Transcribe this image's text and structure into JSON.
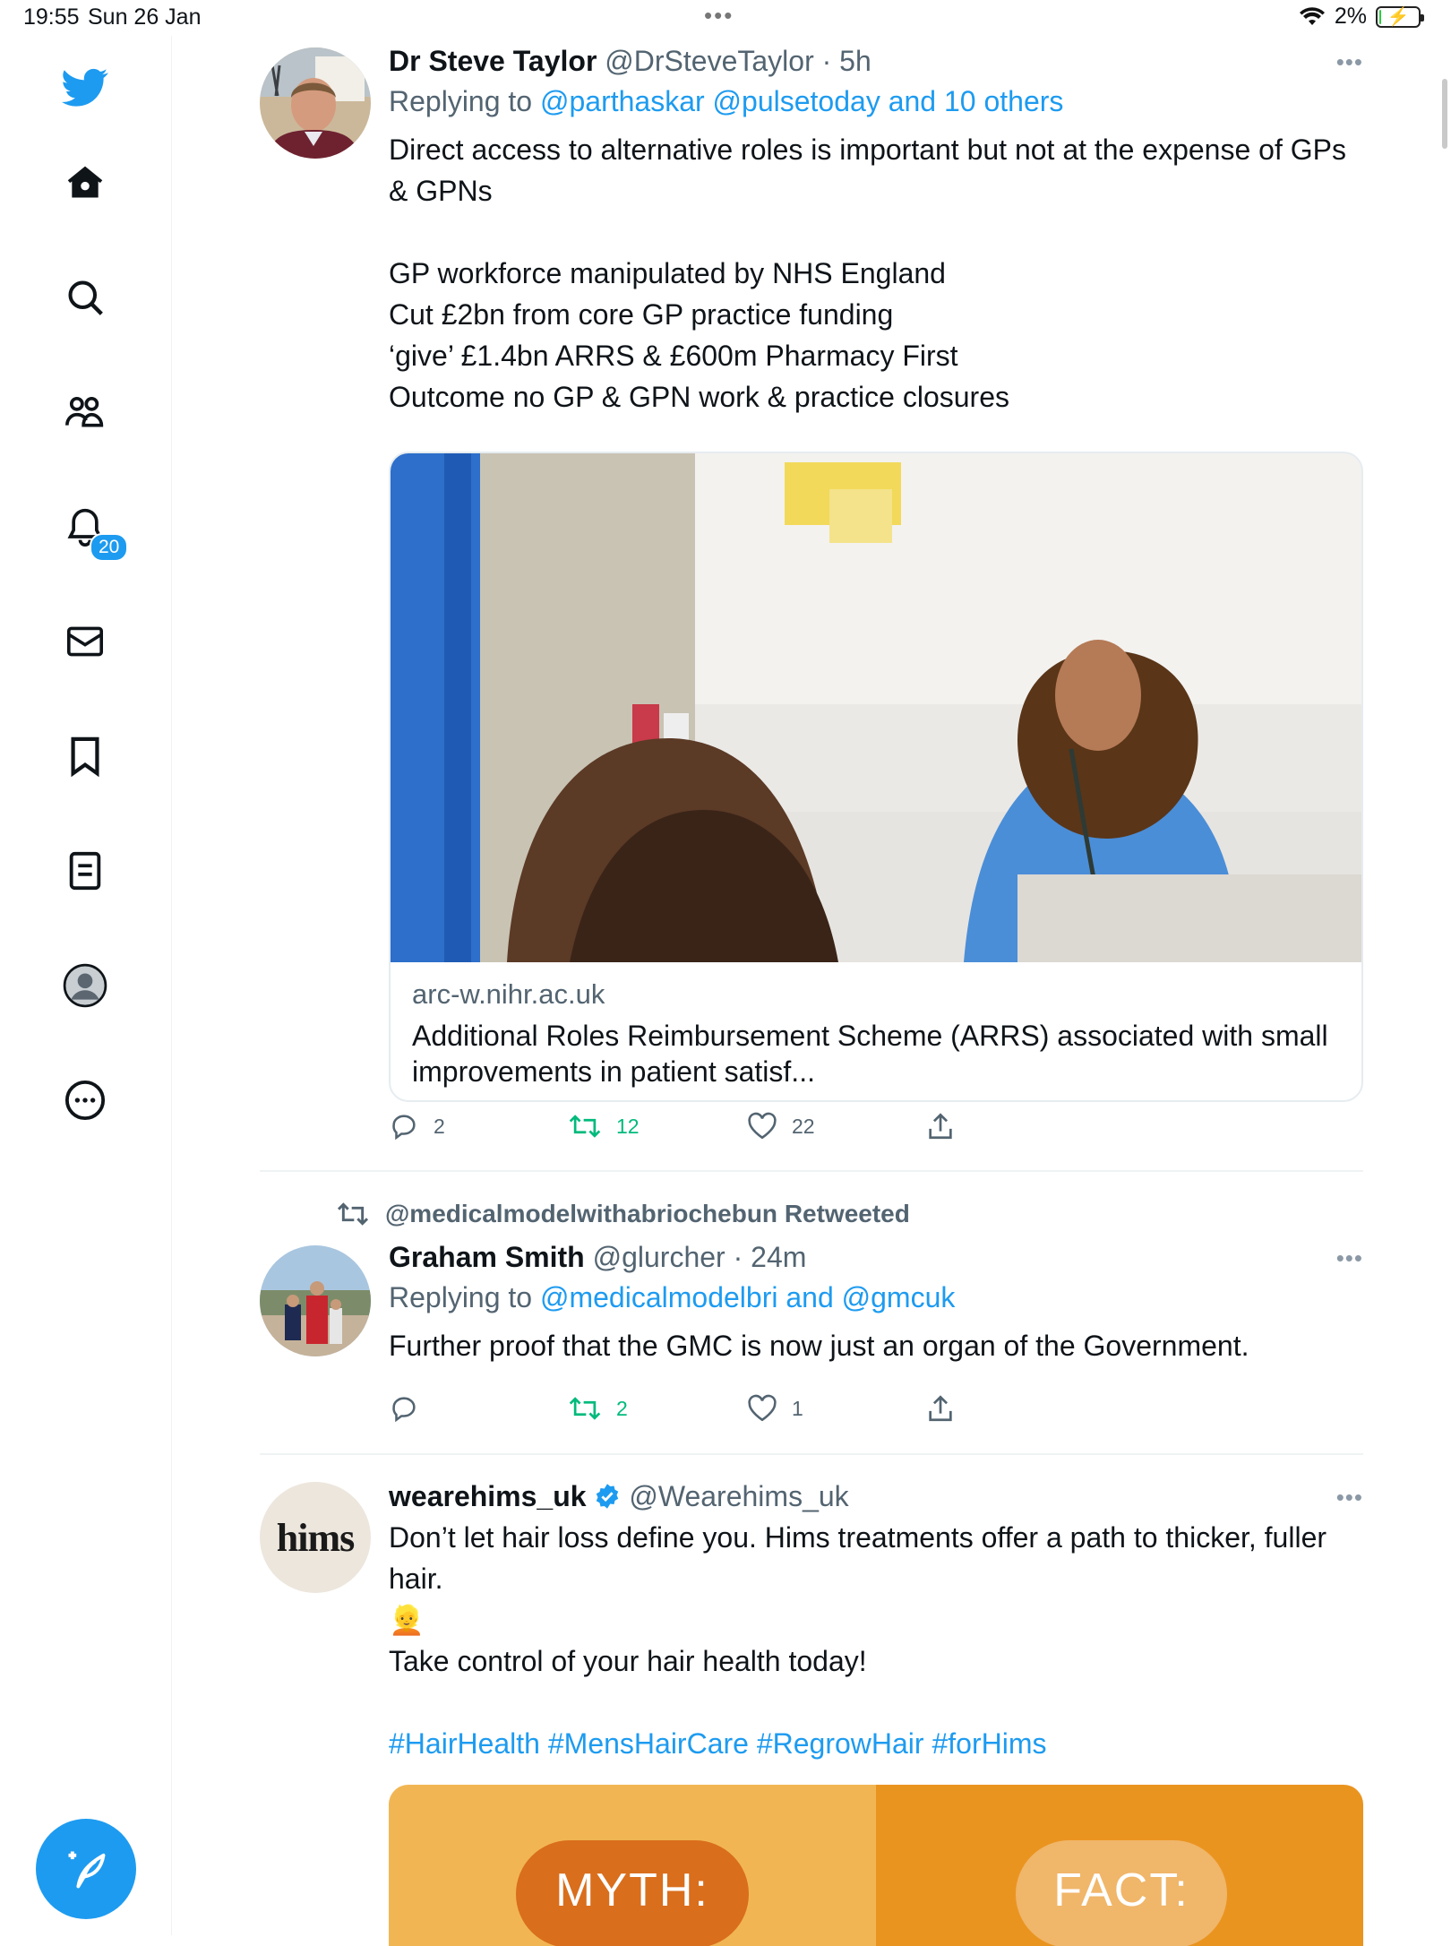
{
  "status_bar": {
    "time": "19:55",
    "date": "Sun 26 Jan",
    "battery": "2%",
    "battery_level": 0.02
  },
  "sidebar": {
    "items": [
      {
        "name": "home",
        "icon": "home-icon"
      },
      {
        "name": "explore",
        "icon": "search-icon"
      },
      {
        "name": "communities",
        "icon": "people-icon"
      },
      {
        "name": "notifications",
        "icon": "bell-icon"
      },
      {
        "name": "messages",
        "icon": "mail-icon"
      },
      {
        "name": "bookmarks",
        "icon": "bookmark-icon"
      },
      {
        "name": "lists",
        "icon": "list-icon"
      },
      {
        "name": "profile",
        "icon": "profile-icon"
      },
      {
        "name": "more",
        "icon": "more-circle-icon"
      }
    ],
    "notification_badge": "20",
    "compose": "compose-icon"
  },
  "tweets": [
    {
      "name": "Dr Steve Taylor",
      "handle": "@DrSteveTaylor",
      "time": "· 5h",
      "replying_prefix": "Replying to ",
      "replying_to": "@parthaskar @pulsetoday and 10 others",
      "text": "Direct access to alternative roles is important but not at the expense of GPs & GPNs\n\nGP workforce manipulated by NHS England\nCut £2bn from core GP practice funding\n‘give’ £1.4bn ARRS & £600m Pharmacy First\nOutcome no GP & GPN work & practice closures",
      "card": {
        "domain": "arc-w.nihr.ac.uk",
        "title": "Additional Roles Reimbursement Scheme (ARRS) associated with small improvements in patient satisf..."
      },
      "replies": "2",
      "retweets": "12",
      "likes": "22"
    },
    {
      "retweeted_by": "@medicalmodelwithabriochebun Retweeted",
      "name": "Graham Smith",
      "handle": "@glurcher",
      "time": "· 24m",
      "replying_prefix": "Replying to ",
      "replying_to": "@medicalmodelbri and @gmcuk",
      "text": "Further proof that the GMC is now just an organ of the Government.",
      "replies": "",
      "retweets": "2",
      "likes": "1"
    },
    {
      "name": "wearehims_uk",
      "handle": "@Wearehims_uk",
      "avatar_text": "hims",
      "text_a": "Don’t let hair loss define you. Hims treatments offer a path to thicker, fuller hair.",
      "emoji": "👱",
      "text_b": "Take control of your hair health today!",
      "hashtags": "#HairHealth #MensHairCare #RegrowHair #forHims",
      "ad_left": "MYTH:",
      "ad_right": "FACT:"
    }
  ],
  "colors": {
    "accent": "#1d9bf0",
    "retweet": "#00ba7c",
    "muted": "#536471"
  }
}
